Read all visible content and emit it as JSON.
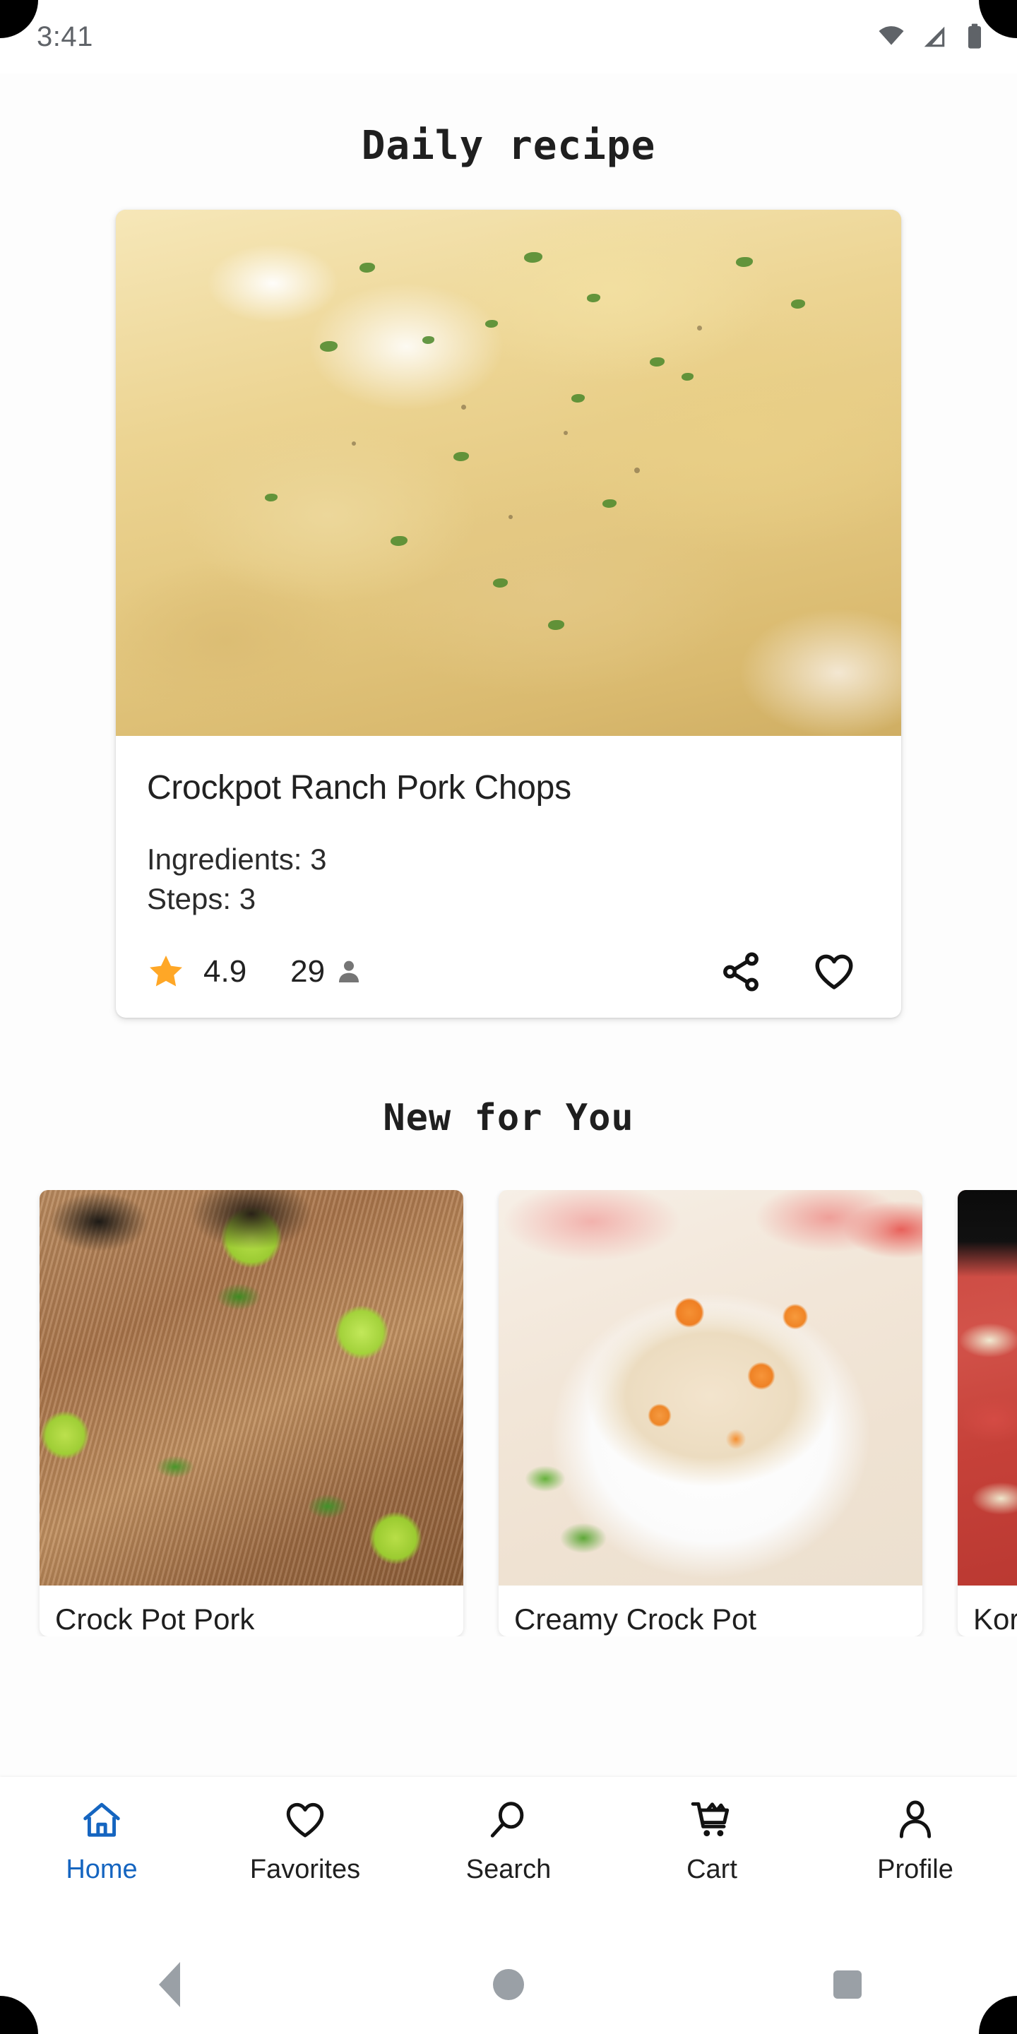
{
  "status_bar": {
    "time": "3:41",
    "icons": [
      "wifi-icon",
      "cellular-signal-icon",
      "battery-icon"
    ]
  },
  "header": {
    "title": "Daily recipe"
  },
  "daily_recipe": {
    "title": "Crockpot Ranch Pork Chops",
    "ingredients_label": "Ingredients: 3",
    "steps_label": "Steps: 3",
    "rating": "4.9",
    "review_count": "29",
    "star_color": "#FFA726",
    "image_alt": "pork chops with creamy ranch gravy and parsley",
    "actions": [
      {
        "name": "share-icon",
        "label": "Share"
      },
      {
        "name": "heart-icon",
        "label": "Favorite"
      }
    ]
  },
  "new_for_you": {
    "title": "New for You",
    "cards": [
      {
        "title": "Crock Pot Pork",
        "image_alt": "shredded pulled pork with lime wedges and cilantro"
      },
      {
        "title": "Creamy Crock Pot",
        "image_alt": "creamy soup with carrots in a white bowl"
      },
      {
        "title": "Kore",
        "image_alt": "raw sliced beef with onions"
      }
    ]
  },
  "bottom_nav": {
    "active_color": "#1565C0",
    "items": [
      {
        "label": "Home",
        "icon": "home-icon",
        "active": true
      },
      {
        "label": "Favorites",
        "icon": "heart-icon",
        "active": false
      },
      {
        "label": "Search",
        "icon": "search-icon",
        "active": false
      },
      {
        "label": "Cart",
        "icon": "cart-icon",
        "active": false
      },
      {
        "label": "Profile",
        "icon": "person-icon",
        "active": false
      }
    ]
  },
  "system_nav": {
    "buttons": [
      {
        "name": "back-button",
        "icon": "triangle-left-icon"
      },
      {
        "name": "home-button",
        "icon": "circle-icon"
      },
      {
        "name": "recents-button",
        "icon": "square-icon"
      }
    ]
  }
}
